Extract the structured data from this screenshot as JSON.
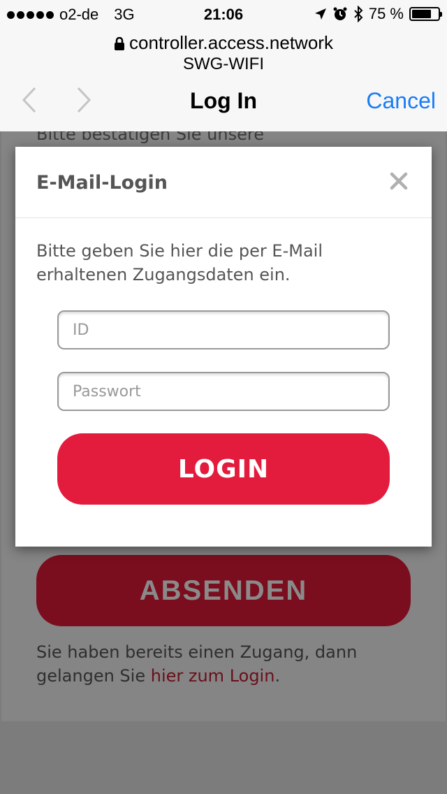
{
  "status": {
    "carrier": "o2-de",
    "network": "3G",
    "time": "21:06",
    "battery_text": "75 %",
    "battery_level": 0.75
  },
  "browser": {
    "url": "controller.access.network",
    "ssid": "SWG-WIFI",
    "title": "Log In",
    "cancel": "Cancel"
  },
  "page": {
    "top_text": "Bitte bestätigen Sie unsere",
    "submit_label": "ABSENDEN",
    "already_text": "Sie haben bereits einen Zugang, dann gelangen Sie ",
    "login_link": "hier zum Login",
    "already_end": "."
  },
  "modal": {
    "title": "E-Mail-Login",
    "description": "Bitte geben Sie hier die per E-Mail erhaltenen Zugangsdaten ein.",
    "id_placeholder": "ID",
    "password_placeholder": "Passwort",
    "login_label": "LOGIN"
  },
  "colors": {
    "accent_blue": "#1a7cf5",
    "login_red": "#e31b3c",
    "dimmed_red": "#7b0e1e"
  }
}
